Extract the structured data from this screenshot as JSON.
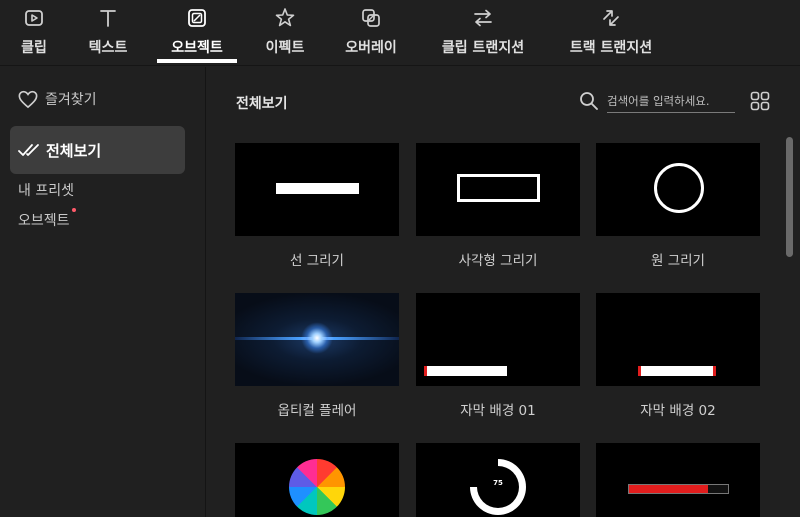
{
  "tabs": [
    {
      "id": "clip",
      "label": "클립",
      "icon": "play-icon"
    },
    {
      "id": "text",
      "label": "텍스트",
      "icon": "text-icon"
    },
    {
      "id": "object",
      "label": "오브젝트",
      "icon": "object-icon",
      "active": true
    },
    {
      "id": "effect",
      "label": "이펙트",
      "icon": "effect-icon"
    },
    {
      "id": "overlay",
      "label": "오버레이",
      "icon": "overlay-icon"
    },
    {
      "id": "clip-transition",
      "label": "클립 트랜지션",
      "icon": "transition-icon"
    },
    {
      "id": "track-transition",
      "label": "트랙 트랜지션",
      "icon": "track-transition-icon"
    }
  ],
  "sidebar": {
    "favorites": "즐겨찾기",
    "all_view": "전체보기",
    "my_presets": "내 프리셋",
    "objects": "오브젝트"
  },
  "main": {
    "title": "전체보기",
    "search_placeholder": "검색어를 입력하세요."
  },
  "items": [
    {
      "label": "선 그리기",
      "thumb": "line"
    },
    {
      "label": "사각형 그리기",
      "thumb": "rect"
    },
    {
      "label": "원 그리기",
      "thumb": "circle"
    },
    {
      "label": "옵티컬 플레어",
      "thumb": "flare"
    },
    {
      "label": "자막 배경 01",
      "thumb": "sub01"
    },
    {
      "label": "자막 배경 02",
      "thumb": "sub02"
    },
    {
      "label": "",
      "thumb": "pie"
    },
    {
      "label": "",
      "thumb": "ring",
      "value": "75"
    },
    {
      "label": "",
      "thumb": "bar"
    }
  ],
  "colors": {
    "accent_red": "#e11d1d",
    "notification_dot": "#ff5a6a",
    "flare_blue": "#3a8cff"
  }
}
